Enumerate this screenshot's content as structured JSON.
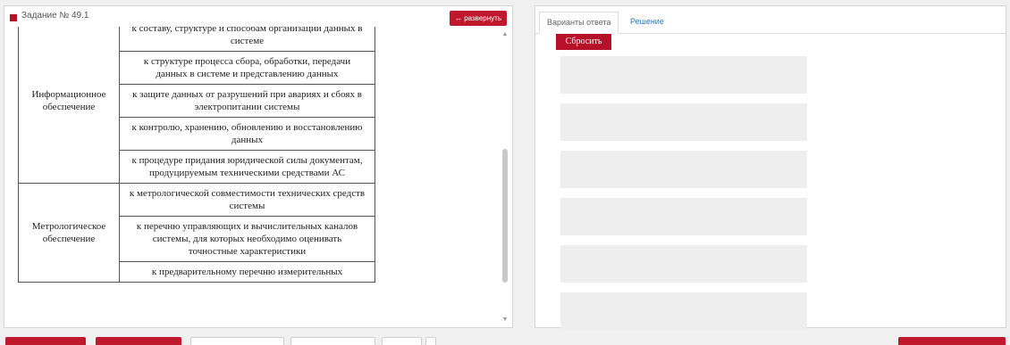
{
  "task": {
    "title": "Задание № 49.1",
    "expand_label": "↔ развернуть"
  },
  "table": {
    "rows": [
      {
        "category": "Информационное обеспечение",
        "items": [
          "к составу, структуре и способам организации данных в системе",
          "к структуре процесса сбора, обработки, передачи данных в системе и представлению данных",
          "к защите данных от разрушений при авариях и сбоях в электропитании системы",
          "к контролю, хранению, обновлению и восстановлению данных",
          "к процедуре придания юридической силы документам, продуцируемым техническими средствами АС"
        ]
      },
      {
        "category": "Метрологическое обеспечение",
        "items": [
          "к метрологической совместимости технических средств системы",
          "к перечню управляющих и вычислительных каналов системы, для которых необходимо оценивать точностные характеристики",
          "к предварительному перечню измерительных"
        ]
      }
    ]
  },
  "answer_panel": {
    "tabs": [
      "Варианты ответа",
      "Решение"
    ],
    "reset_label": "Сбросить",
    "slot_count": 6
  },
  "colors": {
    "accent": "#c0182d",
    "link": "#2a78c4",
    "slot": "#eeeeee"
  }
}
